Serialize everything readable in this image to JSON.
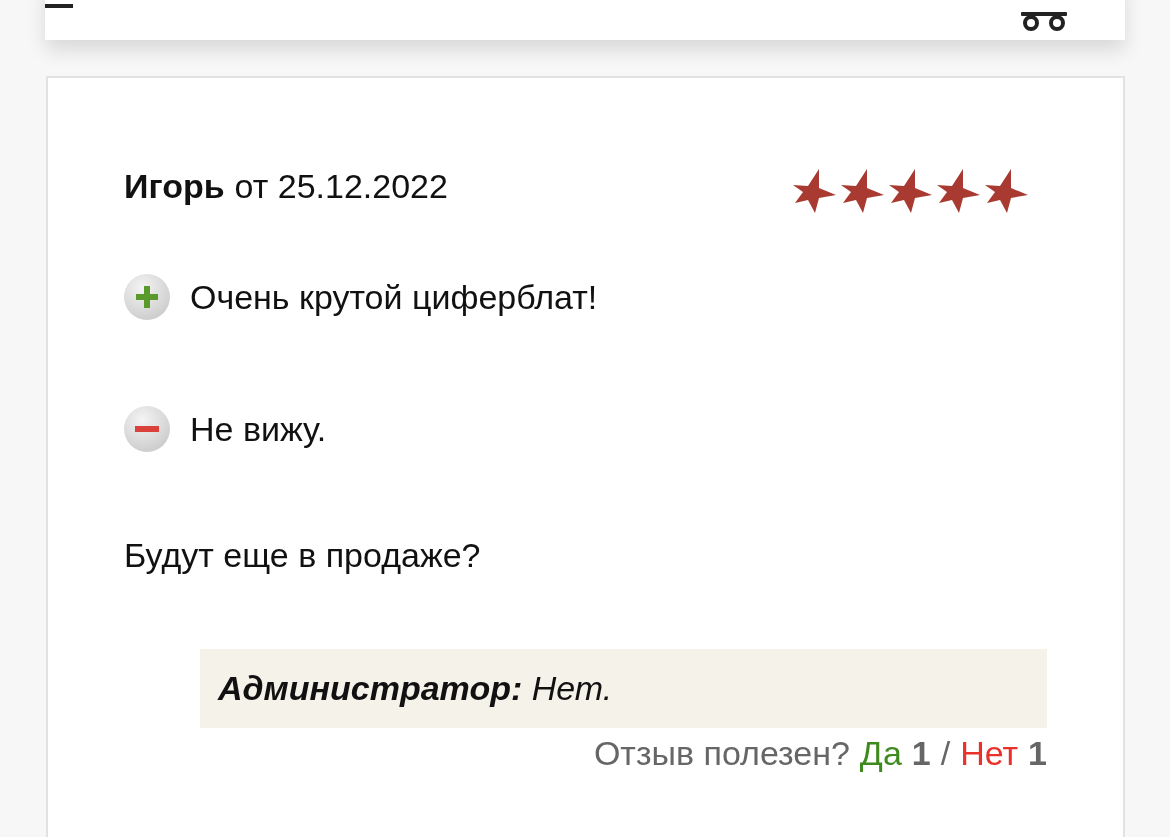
{
  "review": {
    "author": "Игорь",
    "date_text": "от 25.12.2022",
    "stars": 5,
    "pros": "Очень крутой циферблат!",
    "cons": "Не вижу.",
    "comment": "Будут еще в продаже?",
    "admin_reply": "**Администратор:** Нет.",
    "helpful": {
      "question": "Отзыв полезен?",
      "yes_label": "Да",
      "yes_count": "1",
      "separator": "/",
      "no_label": "Нет",
      "no_count": "1"
    }
  }
}
